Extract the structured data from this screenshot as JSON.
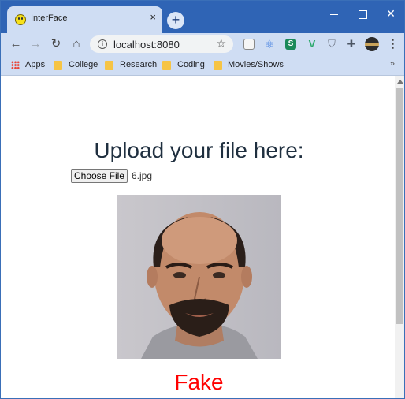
{
  "browser": {
    "tab_title": "InterFace",
    "tab_close": "×",
    "new_tab": "+",
    "url": "localhost:8080",
    "info_glyph": "i",
    "star_glyph": "☆",
    "menu_glyph": "⋮"
  },
  "bookmarks": {
    "items": [
      "Apps",
      "College",
      "Research",
      "Coding",
      "Movies/Shows"
    ],
    "overflow": "»"
  },
  "page": {
    "heading": "Upload your file here:",
    "choose_file_label": "Choose File",
    "file_name": "6.jpg",
    "result": "Fake"
  },
  "colors": {
    "result": "#ff0000",
    "heading": "#1f2f3f",
    "titlebar": "#2f64b5",
    "toolbar": "#cfddf3"
  }
}
